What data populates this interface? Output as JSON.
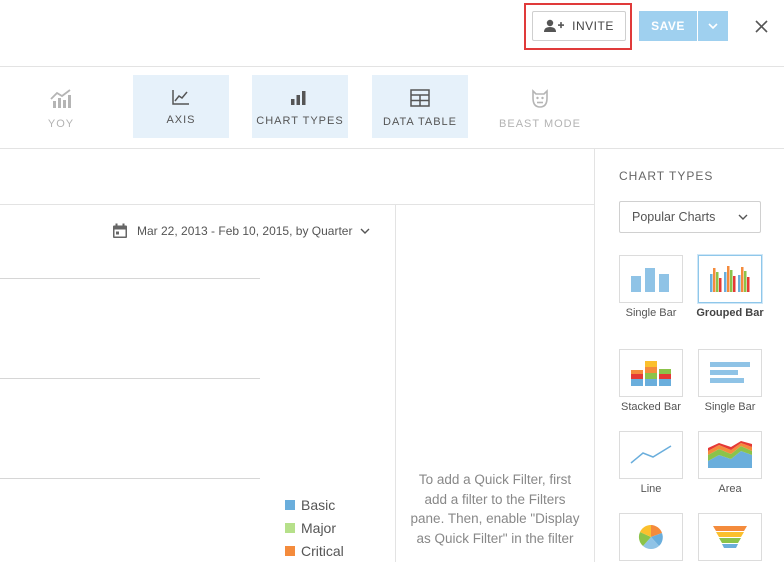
{
  "header": {
    "invite_label": "INVITE",
    "save_label": "SAVE"
  },
  "toolbar": {
    "items": [
      {
        "label": "YOY",
        "icon": "yoy-chart-icon",
        "state": "disabled"
      },
      {
        "label": "AXIS",
        "icon": "axis-icon",
        "state": "active"
      },
      {
        "label": "CHART TYPES",
        "icon": "chart-types-icon",
        "state": "active"
      },
      {
        "label": "DATA TABLE",
        "icon": "data-table-icon",
        "state": "active"
      },
      {
        "label": "BEAST MODE",
        "icon": "beast-mode-icon",
        "state": "disabled"
      }
    ]
  },
  "chart": {
    "date_range": "Mar 22, 2013 - Feb 10, 2015, by Quarter",
    "legend": [
      {
        "label": "Basic",
        "color": "#6aaedc"
      },
      {
        "label": "Major",
        "color": "#b6e08a"
      },
      {
        "label": "Critical",
        "color": "#f48b3c"
      }
    ]
  },
  "quick_filter": {
    "text": "To add a Quick Filter, first add a filter to the Filters pane. Then, enable \"Display as Quick Filter\" in the filter"
  },
  "chart_types_panel": {
    "title": "CHART TYPES",
    "dropdown_value": "Popular Charts",
    "items": [
      {
        "label": "Single Bar",
        "icon": "single-bar-chart-icon",
        "selected": false
      },
      {
        "label": "Grouped Bar",
        "icon": "grouped-bar-chart-icon",
        "selected": true
      },
      {
        "label": "Stacked Bar",
        "icon": "stacked-bar-chart-icon",
        "selected": false
      },
      {
        "label": "Single Bar",
        "icon": "horizontal-bar-chart-icon",
        "selected": false
      },
      {
        "label": "Line",
        "icon": "line-chart-icon",
        "selected": false
      },
      {
        "label": "Area",
        "icon": "area-chart-icon",
        "selected": false
      },
      {
        "label": "",
        "icon": "pie-chart-icon",
        "selected": false
      },
      {
        "label": "",
        "icon": "funnel-chart-icon",
        "selected": false
      }
    ]
  },
  "colors": {
    "accent": "#9fd0ef",
    "highlight_border": "#e03a3a",
    "active_tool_bg": "#e6f1fa"
  }
}
